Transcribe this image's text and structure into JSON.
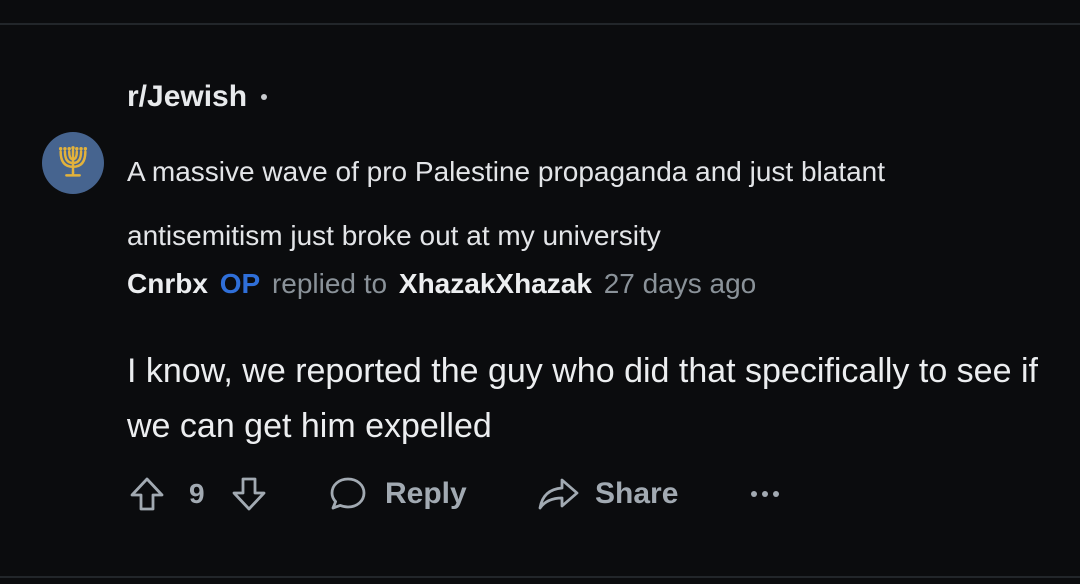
{
  "thread": {
    "subreddit": "r/Jewish",
    "post_title": "A massive wave of pro Palestine propaganda and just blatant antisemitism just broke out at my university"
  },
  "comment": {
    "author": "Cnrbx",
    "op_badge": "OP",
    "replied_text": "replied to",
    "reply_target": "XhazakXhazak",
    "timestamp": "27 days ago",
    "body": "I know, we reported the guy who did that specifically to see if we can get him expelled"
  },
  "actions": {
    "score": "9",
    "reply_label": "Reply",
    "share_label": "Share"
  },
  "colors": {
    "background": "#0b0c0e",
    "avatar": "#46648f",
    "menorah": "#e2b23c",
    "op_badge": "#2f6fd8",
    "meta_text": "#8a9299",
    "action_text": "#a2aab2"
  }
}
